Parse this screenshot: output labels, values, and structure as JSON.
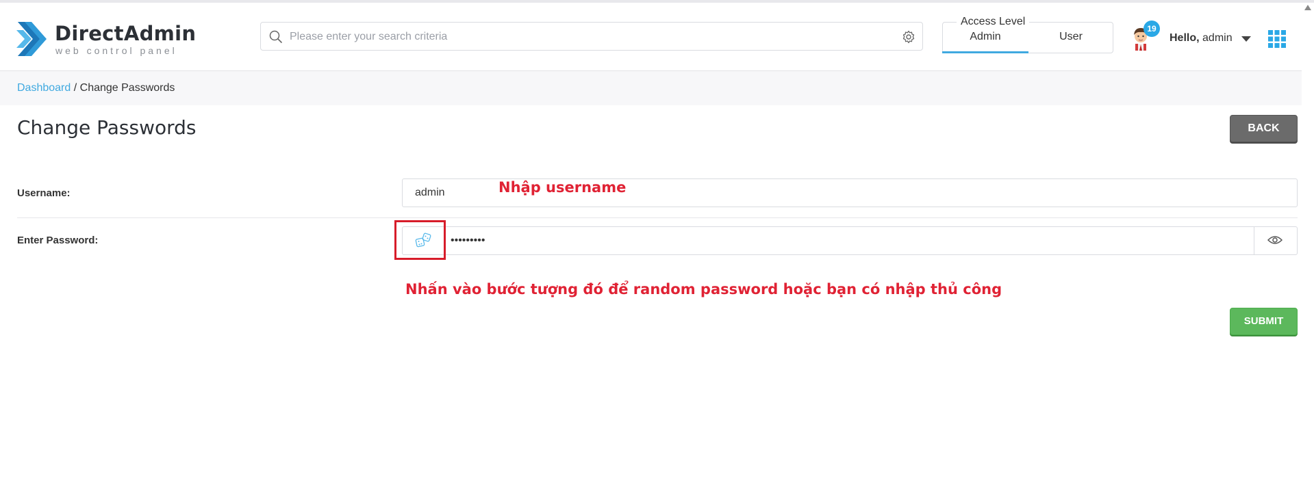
{
  "brand": {
    "title": "DirectAdmin",
    "subtitle": "web control panel",
    "colors": {
      "accent": "#3fa9e0",
      "logo_dark": "#1e7fc0"
    }
  },
  "search": {
    "placeholder": "Please enter your search criteria",
    "value": ""
  },
  "access_level": {
    "label": "Access Level",
    "tabs": [
      {
        "label": "Admin",
        "active": true
      },
      {
        "label": "User",
        "active": false
      }
    ]
  },
  "user_menu": {
    "notification_count": "19",
    "greeting": "Hello,",
    "username": "admin"
  },
  "breadcrumb": {
    "link": "Dashboard",
    "separator": "/",
    "current": "Change Passwords"
  },
  "page": {
    "title": "Change Passwords",
    "back_label": "BACK",
    "submit_label": "SUBMIT"
  },
  "form": {
    "username_label": "Username:",
    "username_value": "admin",
    "password_label": "Enter Password:",
    "password_value": "•••••••••"
  },
  "annotations": {
    "username_note": "Nhập username",
    "password_note": "Nhấn vào bước tượng đó để random password hoặc bạn có nhập thủ công",
    "color": "#e02234"
  },
  "icons": {
    "search": "search-icon",
    "settings": "gear-icon",
    "dice": "dice-icon",
    "eye": "eye-icon",
    "apps": "apps-grid-icon",
    "caret": "caret-down-icon"
  }
}
